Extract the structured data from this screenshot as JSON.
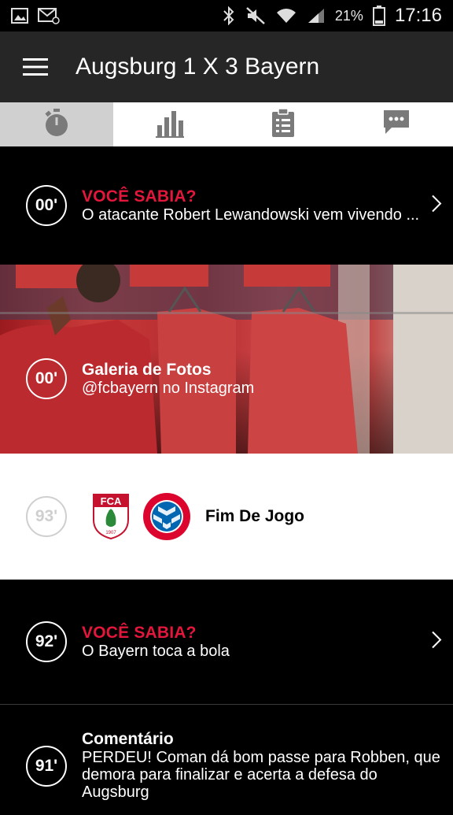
{
  "status_bar": {
    "battery": "21%",
    "time": "17:16",
    "icons": [
      "image-icon",
      "email-icon",
      "bluetooth-icon",
      "mute-icon",
      "wifi-icon",
      "signal-icon",
      "battery-icon"
    ]
  },
  "app_bar": {
    "title": "Augsburg 1 X 3 Bayern",
    "menu_icon": "hamburger-menu-icon"
  },
  "tabs": [
    {
      "icon": "stopwatch-icon",
      "active": true
    },
    {
      "icon": "bar-chart-icon",
      "active": false
    },
    {
      "icon": "clipboard-icon",
      "active": false
    },
    {
      "icon": "chat-icon",
      "active": false
    }
  ],
  "feed": [
    {
      "minute": "00'",
      "label": "VOCÊ SABIA?",
      "text": "O atacante Robert Lewandowski vem vivendo ..."
    },
    {
      "minute": "00'",
      "label": "Galeria de Fotos",
      "text": "@fcbayern no Instagram"
    },
    {
      "minute": "93'",
      "badge_left": "FCA",
      "badge_left_year": "1907",
      "badge_right": "FC BAYERN MÜNCHEN",
      "label": "Fim De Jogo"
    },
    {
      "minute": "92'",
      "label": "VOCÊ SABIA?",
      "text": "O Bayern toca a bola"
    },
    {
      "minute": "91'",
      "label": "Comentário",
      "text": "PERDEU! Coman dá bom passe para Robben, que demora para finalizar e acerta a defesa do Augsburg"
    }
  ],
  "colors": {
    "accent_red": "#e3163b",
    "appbar": "#262626",
    "tab_active": "#d0d0d0"
  }
}
